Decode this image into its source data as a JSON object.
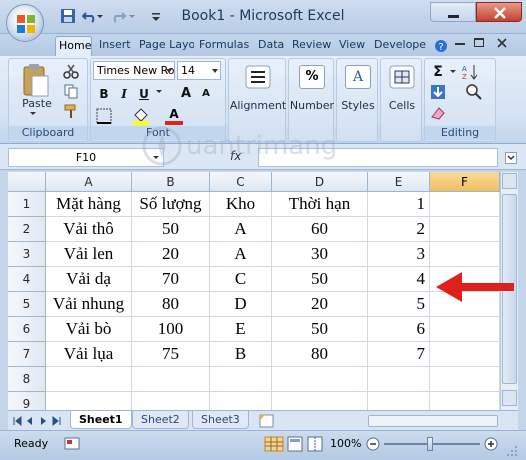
{
  "window": {
    "title": "Book1 - Microsoft Excel"
  },
  "tabs": [
    "Home",
    "Insert",
    "Page Layo",
    "Formulas",
    "Data",
    "Review",
    "View",
    "Developer"
  ],
  "ribbon": {
    "clipboard": {
      "paste_label": "Paste",
      "group_label": "Clipboard"
    },
    "font": {
      "name": "Times New Ro",
      "size": "14",
      "group_label": "Font",
      "bold": "B",
      "italic": "I",
      "underline": "U",
      "font_color_letter": "A",
      "grow": "A",
      "shrink": "A"
    },
    "alignment": {
      "label": "Alignment"
    },
    "number": {
      "label": "Number",
      "icon_text": "%"
    },
    "styles": {
      "label": "Styles",
      "icon_text": "A"
    },
    "cells": {
      "label": "Cells"
    },
    "editing": {
      "group_label": "Editing",
      "sigma": "Σ"
    }
  },
  "formula_bar": {
    "name_box": "F10",
    "fx": "fx",
    "formula": ""
  },
  "sheet": {
    "columns": [
      "A",
      "B",
      "C",
      "D",
      "E",
      "F"
    ],
    "selected_column": "F",
    "rows": [
      "1",
      "2",
      "3",
      "4",
      "5",
      "6",
      "7",
      "8",
      "9"
    ],
    "cells": [
      [
        "Mặt hàng",
        "Số lượng",
        "Kho",
        "Thời hạn",
        "1",
        ""
      ],
      [
        "Vải thô",
        "50",
        "A",
        "60",
        "2",
        ""
      ],
      [
        "Vải len",
        "20",
        "A",
        "30",
        "3",
        ""
      ],
      [
        "Vải dạ",
        "70",
        "C",
        "50",
        "4",
        ""
      ],
      [
        "Vải nhung",
        "80",
        "D",
        "20",
        "5",
        ""
      ],
      [
        "Vải bò",
        "100",
        "E",
        "50",
        "6",
        ""
      ],
      [
        "Vải lụa",
        "75",
        "B",
        "80",
        "7",
        ""
      ],
      [
        "",
        "",
        "",
        "",
        "",
        ""
      ],
      [
        "",
        "",
        "",
        "",
        "",
        ""
      ]
    ]
  },
  "sheet_tabs": [
    "Sheet1",
    "Sheet2",
    "Sheet3"
  ],
  "active_sheet": "Sheet1",
  "status": {
    "ready": "Ready",
    "zoom": "100%"
  },
  "annotation": {
    "arrow_color": "#e0201b"
  },
  "watermark": "Quantrimang"
}
